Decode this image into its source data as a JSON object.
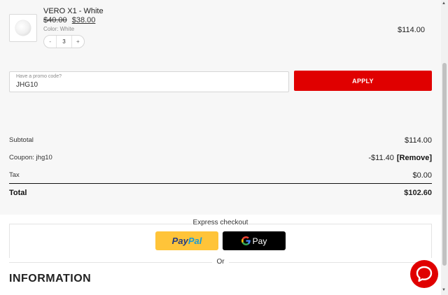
{
  "product": {
    "name": "VERO X1 - White",
    "old_price": "$40.00",
    "new_price": "$38.00",
    "variant": "Color: White",
    "quantity": "3",
    "qty_minus": "-",
    "qty_plus": "+",
    "line_total": "$114.00"
  },
  "promo": {
    "label": "Have a promo code?",
    "value": "JHG10",
    "apply_label": "APPLY"
  },
  "summary": {
    "subtotal_label": "Subtotal",
    "subtotal_value": "$114.00",
    "coupon_label": "Coupon: jhg10",
    "coupon_value": "-$11.40",
    "remove_label": "[Remove]",
    "tax_label": "Tax",
    "tax_value": "$0.00",
    "total_label": "Total",
    "total_value": "$102.60"
  },
  "express": {
    "title": "Express checkout",
    "paypal_part1": "Pay",
    "paypal_part2": "Pal",
    "gpay_label": "Pay",
    "or_label": "Or"
  },
  "information": {
    "heading": "INFORMATION"
  },
  "icons": {
    "chat": "chat-bubble-icon",
    "google": "google-g-icon"
  },
  "colors": {
    "accent": "#e00000",
    "paypal_yellow": "#ffc439",
    "gpay_black": "#000000"
  }
}
